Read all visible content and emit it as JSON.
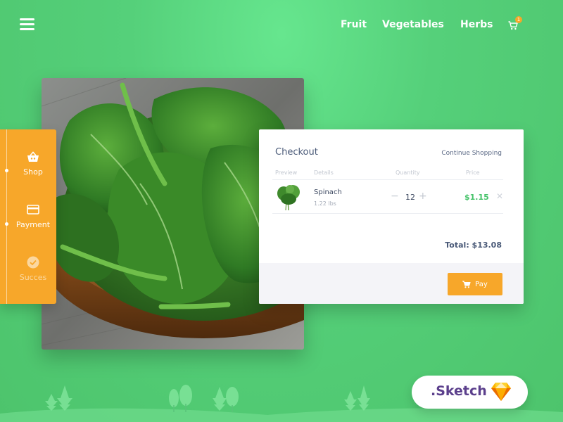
{
  "nav": {
    "items": [
      "Fruit",
      "Vegetables",
      "Herbs"
    ],
    "cart_count": "1"
  },
  "steps": [
    {
      "label": "Shop",
      "icon": "basket-icon",
      "state": "active"
    },
    {
      "label": "Payment",
      "icon": "credit-card-icon",
      "state": "active"
    },
    {
      "label": "Succes",
      "icon": "check-circle-icon",
      "state": "inactive"
    }
  ],
  "checkout": {
    "title": "Checkout",
    "continue_label": "Continue Shopping",
    "headers": {
      "preview": "Preview",
      "details": "Details",
      "quantity": "Quantity",
      "price": "Price"
    },
    "item": {
      "name": "Spinach",
      "weight": "1.22 lbs",
      "quantity": "12",
      "price": "$1.15"
    },
    "total": "Total: $13.08",
    "pay_label": "Pay"
  },
  "badge": {
    "label": ".Sketch"
  },
  "colors": {
    "background": "#55d07a",
    "accent": "#f7a72a",
    "price_green": "#46c36a",
    "text_dark": "#4a5a78"
  }
}
